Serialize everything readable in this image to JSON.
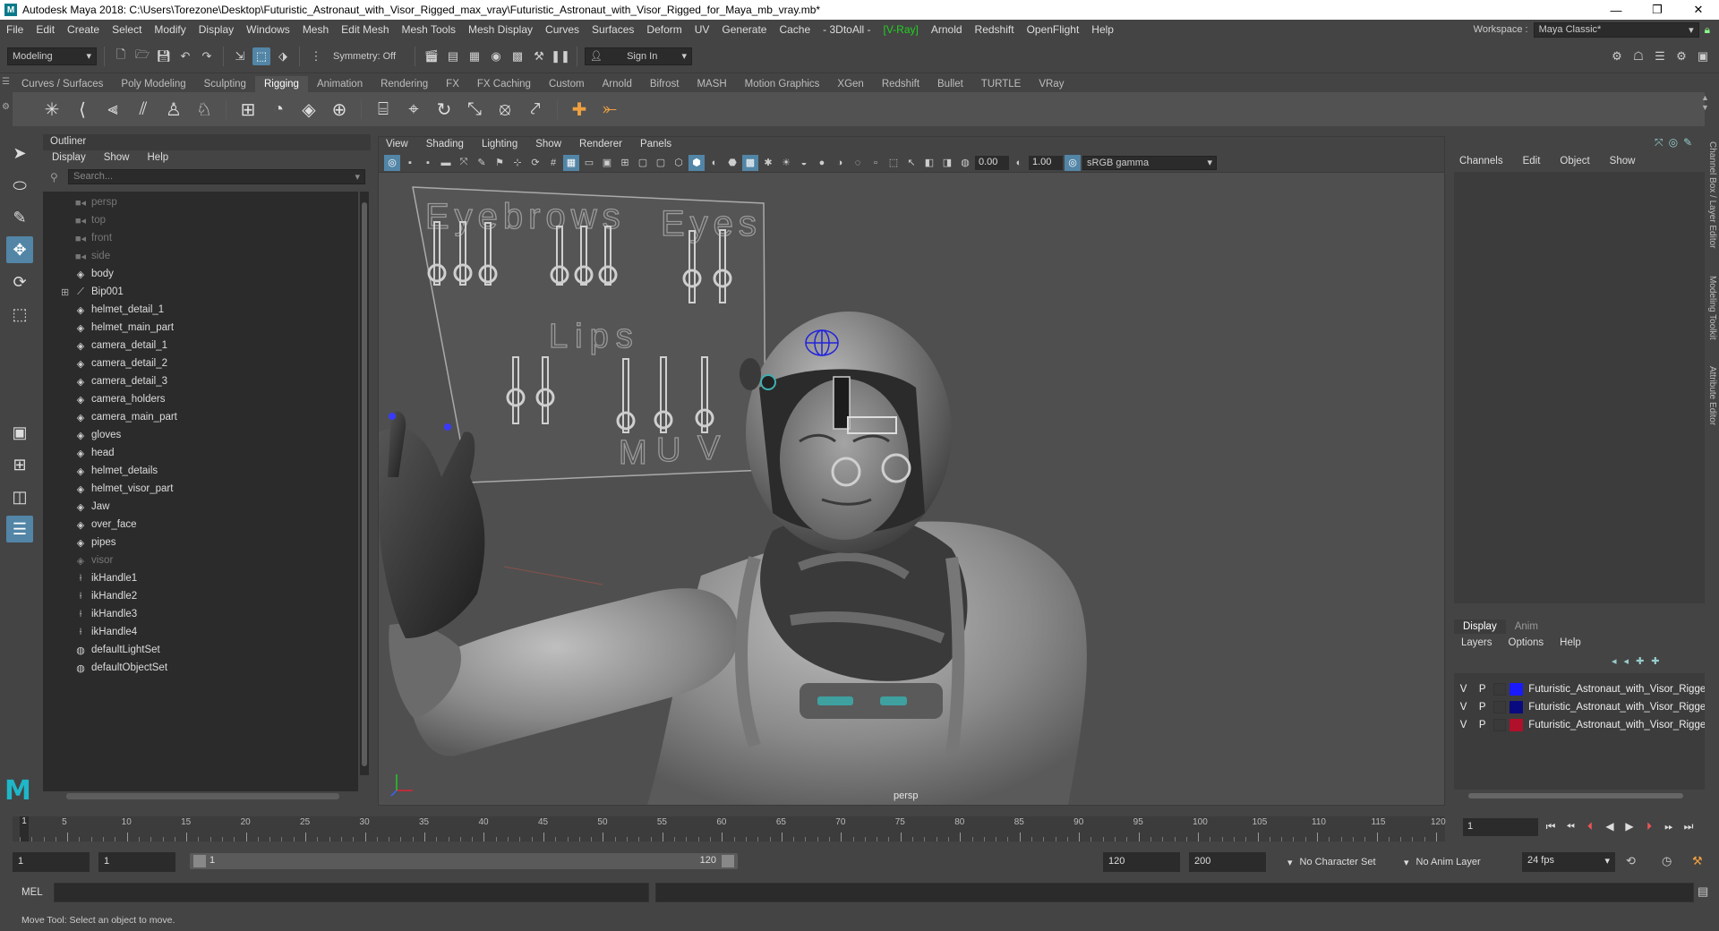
{
  "window": {
    "icon_label": "M",
    "title": "Autodesk Maya 2018: C:\\Users\\Torezone\\Desktop\\Futuristic_Astronaut_with_Visor_Rigged_max_vray\\Futuristic_Astronaut_with_Visor_Rigged_for_Maya_mb_vray.mb*",
    "minimize": "—",
    "restore": "❐",
    "close": "✕"
  },
  "menubar": [
    "File",
    "Edit",
    "Create",
    "Select",
    "Modify",
    "Display",
    "Windows",
    "Mesh",
    "Edit Mesh",
    "Mesh Tools",
    "Mesh Display",
    "Curves",
    "Surfaces",
    "Deform",
    "UV",
    "Generate",
    "Cache",
    "- 3DtoAll -",
    "[V-Ray]",
    "Arnold",
    "Redshift",
    "OpenFlight",
    "Help"
  ],
  "workspace": {
    "label": "Workspace :",
    "value": "Maya Classic*"
  },
  "statusline": {
    "mode": "Modeling",
    "symmetry": "Symmetry: Off",
    "signin": "Sign In"
  },
  "shelf_tabs": [
    "Curves / Surfaces",
    "Poly Modeling",
    "Sculpting",
    "Rigging",
    "Animation",
    "Rendering",
    "FX",
    "FX Caching",
    "Custom",
    "Arnold",
    "Bifrost",
    "MASH",
    "Motion Graphics",
    "XGen",
    "Redshift",
    "Bullet",
    "TURTLE",
    "VRay"
  ],
  "shelf_active": "Rigging",
  "outliner": {
    "title": "Outliner",
    "menu": [
      "Display",
      "Show",
      "Help"
    ],
    "search_placeholder": "Search...",
    "items": [
      {
        "label": "persp",
        "icon": "camera-icon",
        "dim": true
      },
      {
        "label": "top",
        "icon": "camera-icon",
        "dim": true
      },
      {
        "label": "front",
        "icon": "camera-icon",
        "dim": true
      },
      {
        "label": "side",
        "icon": "camera-icon",
        "dim": true
      },
      {
        "label": "body",
        "icon": "transform-icon",
        "dim": false
      },
      {
        "label": "Bip001",
        "icon": "joint-icon",
        "dim": false,
        "expandable": true
      },
      {
        "label": "helmet_detail_1",
        "icon": "transform-icon",
        "dim": false
      },
      {
        "label": "helmet_main_part",
        "icon": "transform-icon",
        "dim": false
      },
      {
        "label": "camera_detail_1",
        "icon": "transform-icon",
        "dim": false
      },
      {
        "label": "camera_detail_2",
        "icon": "transform-icon",
        "dim": false
      },
      {
        "label": "camera_detail_3",
        "icon": "transform-icon",
        "dim": false
      },
      {
        "label": "camera_holders",
        "icon": "transform-icon",
        "dim": false
      },
      {
        "label": "camera_main_part",
        "icon": "transform-icon",
        "dim": false
      },
      {
        "label": "gloves",
        "icon": "transform-icon",
        "dim": false
      },
      {
        "label": "head",
        "icon": "transform-icon",
        "dim": false
      },
      {
        "label": "helmet_details",
        "icon": "transform-icon",
        "dim": false
      },
      {
        "label": "helmet_visor_part",
        "icon": "transform-icon",
        "dim": false
      },
      {
        "label": "Jaw",
        "icon": "transform-icon",
        "dim": false
      },
      {
        "label": "over_face",
        "icon": "transform-icon",
        "dim": false
      },
      {
        "label": "pipes",
        "icon": "transform-icon",
        "dim": false
      },
      {
        "label": "visor",
        "icon": "transform-icon",
        "dim": true
      },
      {
        "label": "ikHandle1",
        "icon": "ik-handle-icon",
        "dim": false
      },
      {
        "label": "ikHandle2",
        "icon": "ik-handle-icon",
        "dim": false
      },
      {
        "label": "ikHandle3",
        "icon": "ik-handle-icon",
        "dim": false
      },
      {
        "label": "ikHandle4",
        "icon": "ik-handle-icon",
        "dim": false
      },
      {
        "label": "defaultLightSet",
        "icon": "set-icon",
        "dim": false
      },
      {
        "label": "defaultObjectSet",
        "icon": "set-icon",
        "dim": false
      }
    ]
  },
  "viewport": {
    "menu": [
      "View",
      "Shading",
      "Lighting",
      "Show",
      "Renderer",
      "Panels"
    ],
    "exposure": "0.00",
    "gamma": "1.00",
    "colorspace": "sRGB gamma",
    "camera": "persp",
    "board": {
      "eyebrows": "Eyebrows",
      "eyes": "Eyes",
      "lips": "Lips",
      "m": "M",
      "u": "U",
      "v": "V"
    }
  },
  "channelbox": {
    "menu": [
      "Channels",
      "Edit",
      "Object",
      "Show"
    ],
    "tabs": [
      "Display",
      "Anim"
    ],
    "layer_menu": [
      "Layers",
      "Options",
      "Help"
    ],
    "layers": [
      {
        "v": "V",
        "p": "P",
        "name": "Futuristic_Astronaut_with_Visor_Rigged",
        "color": "#1a1aff"
      },
      {
        "v": "V",
        "p": "P",
        "name": "Futuristic_Astronaut_with_Visor_Rigged",
        "color": "#0a0a80"
      },
      {
        "v": "V",
        "p": "P",
        "name": "Futuristic_Astronaut_with_Visor_Rigged",
        "color": "#b0102a"
      }
    ],
    "side_tabs": [
      "Channel Box / Layer Editor",
      "Modeling Toolkit",
      "Attribute Editor"
    ]
  },
  "timeline": {
    "labels": [
      5,
      10,
      15,
      20,
      25,
      30,
      35,
      40,
      45,
      50,
      55,
      60,
      65,
      70,
      75,
      80,
      85,
      90,
      95,
      100,
      105,
      110,
      115,
      120
    ],
    "current": "1",
    "current_frame_field": "1"
  },
  "range": {
    "start": "1",
    "start_inner": "1",
    "slider_start": "1",
    "slider_end": "120",
    "end_inner": "120",
    "end": "200",
    "character_set": "No Character Set",
    "anim_layer": "No Anim Layer",
    "fps": "24 fps"
  },
  "command": {
    "label": "MEL"
  },
  "help_line": "Move Tool: Select an object to move."
}
